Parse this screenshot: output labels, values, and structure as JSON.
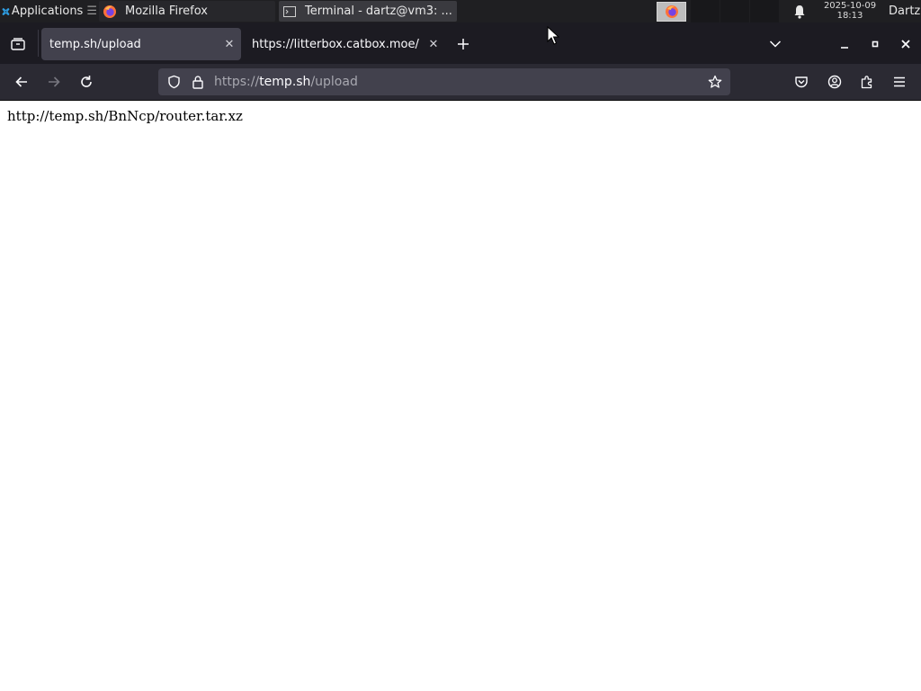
{
  "colors": {
    "panel_bg": "#1f1f22",
    "tabstrip_bg": "#1c1b22",
    "active_tab_bg": "#42414d",
    "navbar_bg": "#2b2a33",
    "urlbar_bg": "#42414d",
    "page_bg": "#ffffff",
    "firefox_orange": "#ff7139",
    "xfce_blue": "#2ea0e6"
  },
  "panel": {
    "applications_label": "Applications",
    "tasks": [
      {
        "label": "Mozilla Firefox",
        "icon": "firefox-icon"
      },
      {
        "label": "Terminal - dartz@vm3: ...",
        "icon": "terminal-icon"
      }
    ],
    "clock": {
      "date": "2025-10-09",
      "time": "18:13"
    },
    "user": "Dartz"
  },
  "browser": {
    "tabs": [
      {
        "title": "temp.sh/upload",
        "active": true
      },
      {
        "title": "https://litterbox.catbox.moe/",
        "active": false
      }
    ],
    "url": {
      "scheme": "https://",
      "domain": "temp.sh",
      "path": "/upload"
    }
  },
  "page": {
    "body_text": "http://temp.sh/BnNcp/router.tar.xz"
  }
}
